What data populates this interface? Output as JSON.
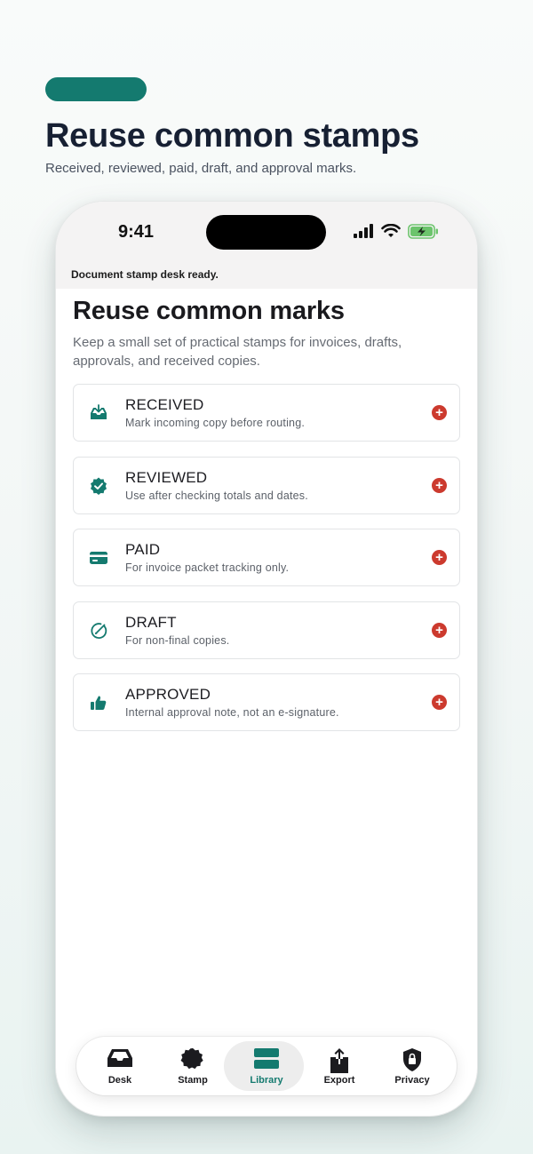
{
  "hero": {
    "title": "Reuse common stamps",
    "subtitle": "Received, reviewed, paid, draft, and approval marks.",
    "accent": "#147a6f"
  },
  "status_bar": {
    "time": "9:41",
    "icons": [
      "signal-icon",
      "wifi-icon",
      "battery-charging-icon"
    ]
  },
  "banner": "Document stamp desk ready.",
  "content": {
    "title": "Reuse common marks",
    "description": "Keep a small set of practical stamps for invoices, drafts, approvals, and received copies."
  },
  "stamps": [
    {
      "title": "RECEIVED",
      "subtitle": "Mark incoming copy before routing.",
      "icon": "inbox-download-icon"
    },
    {
      "title": "REVIEWED",
      "subtitle": "Use after checking totals and dates.",
      "icon": "verified-badge-icon"
    },
    {
      "title": "PAID",
      "subtitle": "For invoice packet tracking only.",
      "icon": "credit-card-icon"
    },
    {
      "title": "DRAFT",
      "subtitle": "For non-final copies.",
      "icon": "pencil-circle-icon"
    },
    {
      "title": "APPROVED",
      "subtitle": "Internal approval note, not an e-signature.",
      "icon": "thumbs-up-icon"
    }
  ],
  "add_button_label": "+",
  "colors": {
    "icon_green": "#147a6f",
    "add_red": "#cc3a2e"
  },
  "tabs": [
    {
      "label": "Desk",
      "icon": "inbox-tray-icon"
    },
    {
      "label": "Stamp",
      "icon": "stamp-seal-icon"
    },
    {
      "label": "Library",
      "icon": "library-stack-icon",
      "active": true
    },
    {
      "label": "Export",
      "icon": "share-export-icon"
    },
    {
      "label": "Privacy",
      "icon": "lock-shield-icon"
    }
  ]
}
